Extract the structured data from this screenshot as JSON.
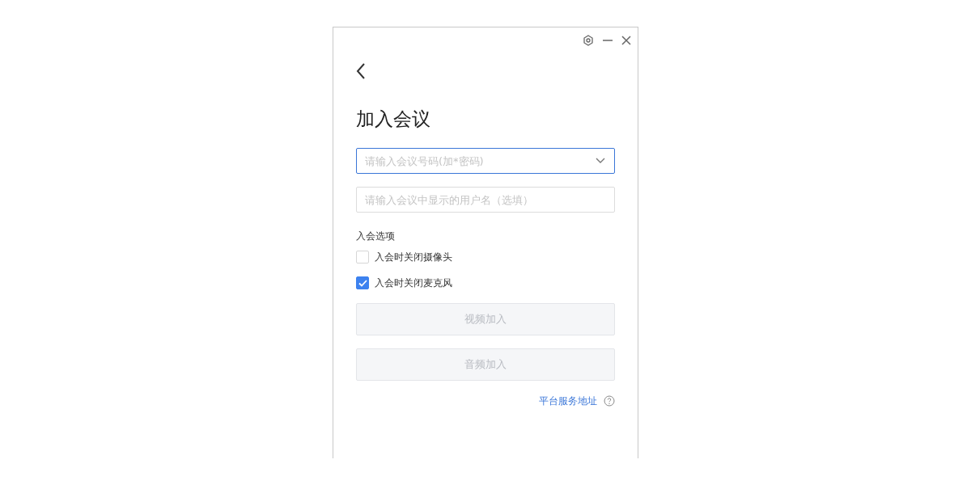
{
  "title": "加入会议",
  "meeting_field": {
    "placeholder": "请输入会议号码(加*密码)",
    "focused": true
  },
  "name_field": {
    "placeholder": "请输入会议中显示的用户名（选填）"
  },
  "options_label": "入会选项",
  "options": [
    {
      "label": "入会时关闭摄像头",
      "checked": false
    },
    {
      "label": "入会时关闭麦克风",
      "checked": true
    }
  ],
  "buttons": [
    {
      "label": "视频加入",
      "disabled": true
    },
    {
      "label": "音频加入",
      "disabled": true
    }
  ],
  "server_link": "平台服务地址"
}
